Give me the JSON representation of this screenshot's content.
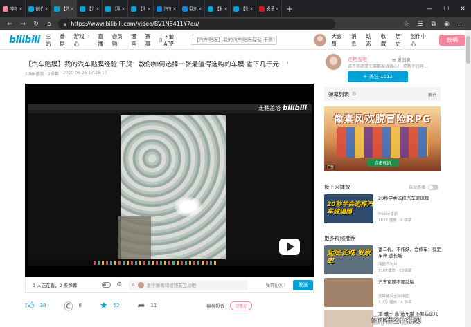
{
  "browser": {
    "tabs": [
      {
        "label": "哔哩哔",
        "color": "#f4869e",
        "active": false
      },
      {
        "label": "创作中",
        "color": "#00a1d6",
        "active": false
      },
      {
        "label": "【汽车",
        "color": "#00a1d6",
        "active": true
      },
      {
        "label": "【汽车",
        "color": "#00a1d6",
        "active": false
      },
      {
        "label": "【明星",
        "color": "#00a1d6",
        "active": false
      },
      {
        "label": "【明星",
        "color": "#00a1d6",
        "active": false
      },
      {
        "label": "汽车》",
        "color": "#0b84d9",
        "active": false
      },
      {
        "label": "我的收",
        "color": "#0b84d9",
        "active": false
      },
      {
        "label": "【秘】",
        "color": "#00a1d6",
        "active": false
      },
      {
        "label": "【领】",
        "color": "#00a1d6",
        "active": false
      },
      {
        "label": "发表新",
        "color": "#d7191c",
        "active": false
      }
    ],
    "new_tab": "+",
    "url": "https://www.bilibili.com/video/BV1N5411Y7eu/"
  },
  "site": {
    "logo": "bilibili",
    "nav": [
      "主站",
      "番剧",
      "游戏中心",
      "直播",
      "会员购",
      "漫画",
      "赛事"
    ],
    "download": "下载APP",
    "search_placeholder": "【汽车贴膜】我的汽车贴膜经验 干货！",
    "right_nav": [
      "大会员",
      "消息",
      "动态",
      "收藏",
      "历史",
      "创作中心"
    ],
    "upload": "投稿"
  },
  "video": {
    "title": "【汽车贴膜】我的汽车贴膜经验 干货！教你如何选择一张最值得选购的车膜 省下几千元！！",
    "views": "5288播放 · 2弹幕",
    "date": "2020-06-25 17:28:10",
    "watermark_text": "走粘盖塔",
    "watermark_logo": "bilibili"
  },
  "danmu": {
    "watching": "1 人正在看，2 条弹幕",
    "placeholder": "发个弹幕和视频友互动吧",
    "etiquette": "弹幕礼仪 〉",
    "send": "发送"
  },
  "actions": {
    "like": "38",
    "coin": "8",
    "fav": "52",
    "share": "11",
    "complain": "稿件投诉",
    "note": "记笔记"
  },
  "up": {
    "name": "走粘盖塔",
    "msg": "发消息",
    "desc": "道不修欲望无蝶都凝拢我心！ 豪胜不行可...",
    "follow": "关注 1012"
  },
  "sidebar": {
    "danmu_list": "弹幕列表",
    "expand": "展开",
    "ad_headline": "像素风欢脱冒险RPG",
    "ad_cta": "点击预约",
    "ad_tag": "广告",
    "next_play": "接下来播放",
    "autoplay": "自动连播",
    "recommend": "更多视频推荐"
  },
  "videos": [
    {
      "thumb": "20秒学会选择汽车玻璃膜",
      "thumb_bg": "#2f4a6b",
      "title": "20秒学会选择汽车玻璃膜",
      "by": "Prolim普丽",
      "stats": "1693 播放 · 0 弹幕",
      "duration": "00:20"
    },
    {
      "thumb": "起底长城 发家史",
      "thumb_bg": "#5d6f7d",
      "title": "富二代、不作妖、会修车：保定车神 遗长城",
      "by": "海盟汽车台",
      "stats": "7107播放 · 63弹幕",
      "duration": "08:17"
    },
    {
      "thumb": "",
      "thumb_bg": "#a0826a",
      "title": "汽车窗膜不要乱贴",
      "by": "宽膜格及全球频道",
      "stats": "7.7万 播放 · 5 弹幕",
      "duration": "03:04"
    },
    {
      "thumb": "",
      "thumb_bg": "#d9c7b5",
      "title": "龙·雅丰 鑫 选车膜 不要在这几个地方...",
      "by": "",
      "stats": "",
      "duration": ""
    }
  ],
  "page_watermark": "值 | 什么值得买"
}
